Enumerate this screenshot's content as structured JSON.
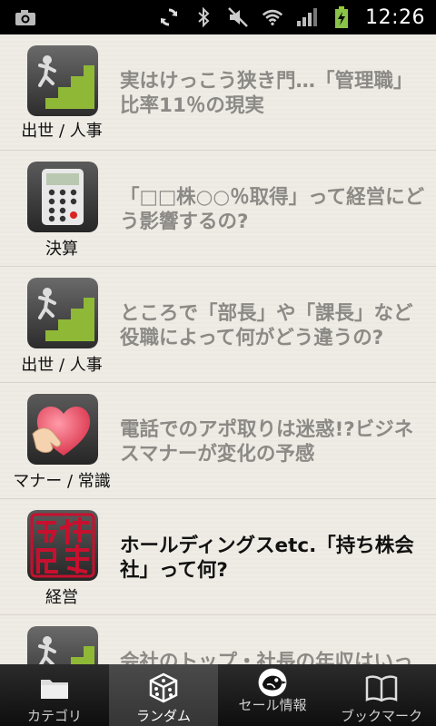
{
  "status_bar": {
    "time": "12:26",
    "icons": [
      "camera-icon",
      "sync-icon",
      "bluetooth-icon",
      "mute-icon",
      "wifi-icon",
      "signal-icon",
      "battery-charging-icon"
    ]
  },
  "articles": [
    {
      "category": "出世 / 人事",
      "title": "実はけっこう狭き門…「管理職」比率11％の現実",
      "read": true,
      "icon": "promotion-stairs-icon"
    },
    {
      "category": "決算",
      "title": "「□□株○○％取得」って経営にどう影響するの?",
      "read": true,
      "icon": "calculator-icon"
    },
    {
      "category": "出世 / 人事",
      "title": "ところで「部長」や「課長」など役職によって何がどう違うの?",
      "read": true,
      "icon": "promotion-stairs-icon"
    },
    {
      "category": "マナー / 常識",
      "title": "電話でのアポ取りは迷惑!?ビジネスマナーが変化の予感",
      "read": true,
      "icon": "heart-hand-icon"
    },
    {
      "category": "経営",
      "title": "ホールディングスetc.「持ち株会社」って何?",
      "read": false,
      "icon": "seal-stamp-icon"
    },
    {
      "category": "",
      "title": "会社のトップ・社長の年収はいっ",
      "read": true,
      "icon": "promotion-stairs-icon"
    }
  ],
  "bottom_nav": {
    "items": [
      {
        "label": "カテゴリ",
        "icon": "folder-icon",
        "active": false
      },
      {
        "label": "ランダム",
        "icon": "dice-icon",
        "active": true
      },
      {
        "label": "セール情報",
        "icon": "sale-bird-icon",
        "active": false
      },
      {
        "label": "ブックマーク",
        "icon": "book-icon",
        "active": false
      }
    ]
  },
  "colors": {
    "background": "#efece5",
    "read_title": "#8c8a86",
    "unread_title": "#111111",
    "nav_bg": "#1a1a1a",
    "nav_active": "#404040"
  }
}
